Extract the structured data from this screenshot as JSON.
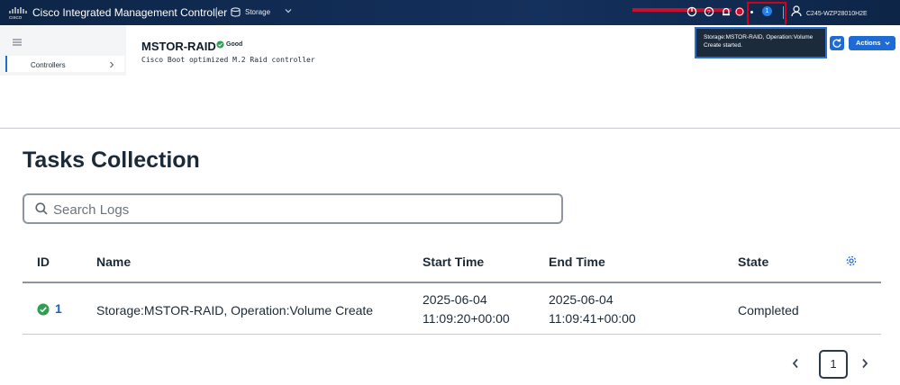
{
  "header": {
    "app_title": "Cisco Integrated Management Controller",
    "breadcrumb_label": "Storage",
    "notification_count": "1",
    "host_name": "C245-WZP28010H2E",
    "accent_color": "#14305c"
  },
  "sidebar": {
    "items": [
      {
        "label": "Controllers"
      }
    ]
  },
  "device": {
    "title": "MSTOR-RAID",
    "status": "Good",
    "subtitle": "Cisco Boot optimized M.2 Raid controller"
  },
  "tooltip": {
    "text": "Storage:MSTOR-RAID, Operation:Volume Create started."
  },
  "toolbar": {
    "actions_label": "Actions"
  },
  "tasks": {
    "title": "Tasks Collection",
    "search_placeholder": "Search Logs",
    "columns": [
      "ID",
      "Name",
      "Start Time",
      "End Time",
      "State"
    ],
    "rows": [
      {
        "id": "1",
        "name": "Storage:MSTOR-RAID, Operation:Volume Create",
        "start_date": "2025-06-04",
        "start_time": "11:09:20+00:00",
        "end_date": "2025-06-04",
        "end_time": "11:09:41+00:00",
        "state": "Completed"
      }
    ]
  },
  "pagination": {
    "current_page": "1"
  }
}
